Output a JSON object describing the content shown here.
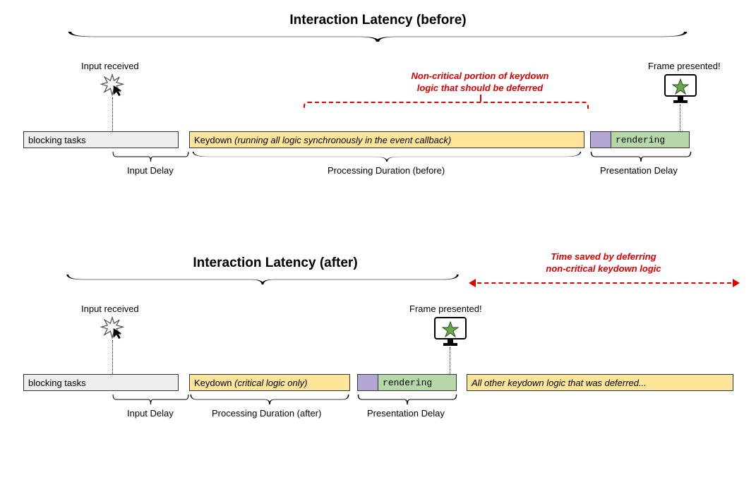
{
  "before": {
    "title": "Interaction Latency (before)",
    "input_label": "Input received",
    "frame_label": "Frame presented!",
    "annotation": "Non-critical portion of keydown\nlogic that should be deferred",
    "segments": {
      "blocking": "blocking tasks",
      "keydown_prefix": "Keydown ",
      "keydown_em": "(running all logic synchronously in the event callback)",
      "rendering": "rendering"
    },
    "braces": {
      "input_delay": "Input Delay",
      "processing": "Processing Duration (before)",
      "presentation": "Presentation Delay"
    }
  },
  "after": {
    "title": "Interaction Latency (after)",
    "input_label": "Input received",
    "frame_label": "Frame presented!",
    "annotation": "Time saved by deferring\nnon-critical keydown logic",
    "segments": {
      "blocking": "blocking tasks",
      "keydown_prefix": "Keydown ",
      "keydown_em": "(critical logic only)",
      "rendering": "rendering",
      "deferred": "All other keydown logic that was deferred..."
    },
    "braces": {
      "input_delay": "Input Delay",
      "processing": "Processing Duration (after)",
      "presentation": "Presentation Delay"
    }
  }
}
